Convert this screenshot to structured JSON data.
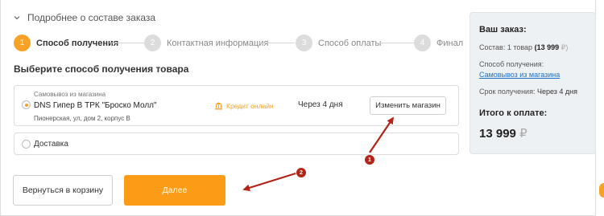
{
  "order_header": {
    "label": "Подробнее о составе заказа"
  },
  "steps": [
    {
      "num": "1",
      "label": "Способ получения",
      "active": true
    },
    {
      "num": "2",
      "label": "Контактная информация",
      "active": false
    },
    {
      "num": "3",
      "label": "Способ оплаты",
      "active": false
    },
    {
      "num": "4",
      "label": "Финал",
      "active": false
    }
  ],
  "section_title": "Выберите способ получения товара",
  "pickup_option": {
    "kicker": "Самовывоз из магазина",
    "store": "DNS Гипер В ТРК \"Броско Молл\"",
    "address": "Пионерская, ул, дом 2, корпус В",
    "credit_label": "Кредит онлайн",
    "credit_icon": "bank-icon",
    "eta": "Через 4 дня",
    "change_label": "Изменить магазин",
    "selected": true
  },
  "delivery_option": {
    "label": "Доставка",
    "selected": false
  },
  "buttons": {
    "back": "Вернуться в корзину",
    "next": "Далее"
  },
  "summary": {
    "title": "Ваш заказ:",
    "composition_label": "Состав:",
    "composition_count": "1 товар",
    "composition_sum": "(13 999",
    "composition_rub": "₽)",
    "method_label": "Способ получения:",
    "method_value": "Самовывоз из магазина",
    "time_label": "Срок получения:",
    "time_value": "Через 4 дня",
    "total_label": "Итого к оплате:",
    "total_value": "13 999",
    "total_rub": "₽"
  },
  "annotations": [
    {
      "num": "1"
    },
    {
      "num": "2"
    }
  ],
  "colors": {
    "accent": "#fb9c17",
    "link": "#1a73c9",
    "annotation": "#b32418",
    "summary_bg": "#eef1f4"
  }
}
